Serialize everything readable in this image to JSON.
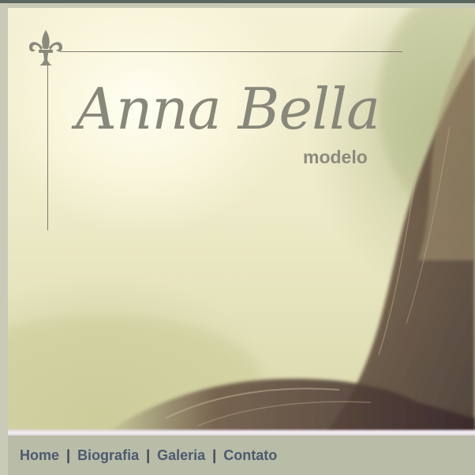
{
  "site": {
    "title": "Anna Bella",
    "subtitle": "modelo"
  },
  "hero": {
    "image": "portrait-photo-hair",
    "ornament_icon": "fleur-de-lis-icon"
  },
  "nav": {
    "items": [
      {
        "label": "Home"
      },
      {
        "label": "Biografia"
      },
      {
        "label": "Galeria"
      },
      {
        "label": "Contato"
      }
    ],
    "separator": "|"
  },
  "colors": {
    "accent": "#87877a",
    "nav_text": "#4b5a72",
    "nav_bg": "#b9bca6",
    "top_rule": "#5a6660"
  }
}
